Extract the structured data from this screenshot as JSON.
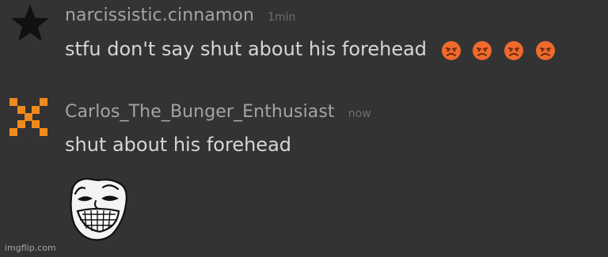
{
  "messages": [
    {
      "username": "narcissistic.cinnamon",
      "timestamp": "1min",
      "text": "stfu don't say shut about his forehead",
      "avatar_icon": "star-icon",
      "avatar_color": "#111111",
      "reactions": [
        "angry-face-icon",
        "angry-face-icon",
        "angry-face-icon",
        "angry-face-icon"
      ]
    },
    {
      "username": "Carlos_The_Bunger_Enthusiast",
      "timestamp": "now",
      "text": "shut about his forehead",
      "avatar_icon": "pixel-x-icon",
      "avatar_color": "#f08a1d",
      "image_icon": "trollface-icon"
    }
  ],
  "watermark": "imgflip.com",
  "colors": {
    "background": "#333333",
    "username": "#a4a4a4",
    "timestamp": "#6f6f6f",
    "text": "#d6d6d6",
    "angry_face": "#ef6a2d"
  }
}
